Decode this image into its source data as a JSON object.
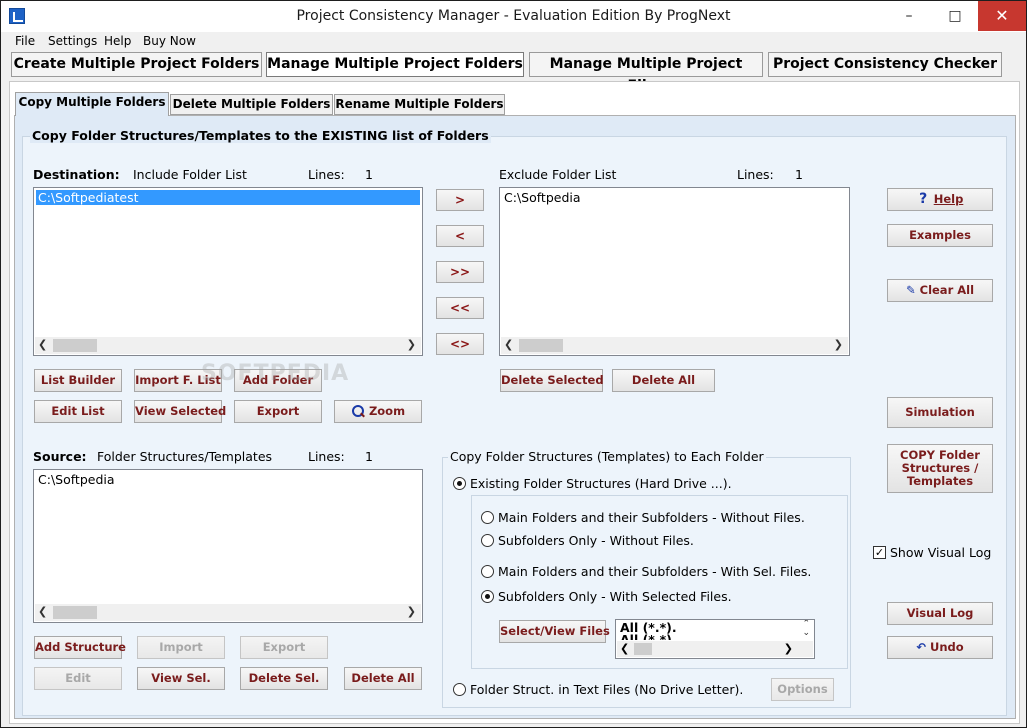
{
  "window": {
    "title": "Project Consistency Manager - Evaluation Edition  By ProgNext",
    "controls": {
      "minimize": "–",
      "maximize": "□",
      "close": "✕"
    }
  },
  "menu": [
    "File",
    "Settings",
    "Help",
    "Buy Now"
  ],
  "main_tabs": [
    {
      "label": "Create Multiple Project Folders",
      "active": false
    },
    {
      "label": "Manage Multiple Project Folders",
      "active": true
    },
    {
      "label": "Manage Multiple Project Files",
      "active": false
    },
    {
      "label": "Project Consistency Checker",
      "active": false
    }
  ],
  "sub_tabs": [
    {
      "label": "Copy Multiple Folders",
      "active": true
    },
    {
      "label": "Delete Multiple Folders",
      "active": false
    },
    {
      "label": "Rename Multiple Folders",
      "active": false
    }
  ],
  "group_title": "Copy Folder Structures/Templates to the EXISTING list of Folders",
  "destination": {
    "label": "Destination:",
    "include_label": "Include Folder List",
    "lines_label": "Lines:",
    "lines": "1",
    "items": [
      "C:\\Softpediatest"
    ]
  },
  "exclude": {
    "label": "Exclude Folder List",
    "lines_label": "Lines:",
    "lines": "1",
    "items": [
      "C:\\Softpedia"
    ]
  },
  "transfer_buttons": [
    ">",
    "<",
    ">>",
    "<<",
    "<>"
  ],
  "dest_buttons": {
    "list_builder": "List Builder",
    "import_f_list": "Import F. List",
    "add_folder": "Add Folder",
    "edit_list": "Edit List",
    "view_selected": "View Selected",
    "export": "Export",
    "zoom": "Zoom"
  },
  "exclude_buttons": {
    "delete_selected": "Delete Selected",
    "delete_all": "Delete All"
  },
  "right_buttons": {
    "help": "Help",
    "examples": "Examples",
    "clear_all": "Clear All",
    "simulation": "Simulation",
    "copy_folder": "COPY Folder Structures / Templates",
    "visual_log": "Visual Log",
    "undo": "Undo"
  },
  "show_visual_log": {
    "label": "Show Visual Log",
    "checked": true
  },
  "source": {
    "label": "Source:",
    "sublabel": "Folder Structures/Templates",
    "lines_label": "Lines:",
    "lines": "1",
    "items": [
      "C:\\Softpedia"
    ]
  },
  "source_buttons": {
    "add_structure": "Add  Structure",
    "import": "Import",
    "export": "Export",
    "edit": "Edit",
    "view_sel": "View Sel.",
    "delete_sel": "Delete Sel.",
    "delete_all": "Delete All"
  },
  "copy_options": {
    "title": "Copy Folder Structures (Templates) to Each Folder",
    "existing": "Existing Folder Structures (Hard Drive ...).",
    "main_without": "Main Folders and their Subfolders - Without Files.",
    "sub_without": "Subfolders Only - Without Files.",
    "main_with": "Main Folders and their Subfolders - With Sel. Files.",
    "sub_with": "Subfolders Only - With Selected Files.",
    "select_view_files": "Select/View Files",
    "filter_items": [
      "All (*.*).",
      "All (*.*)."
    ],
    "text_files": "Folder Struct.  in Text Files (No Drive Letter).",
    "options": "Options"
  },
  "watermark": "SOFTPEDIA"
}
